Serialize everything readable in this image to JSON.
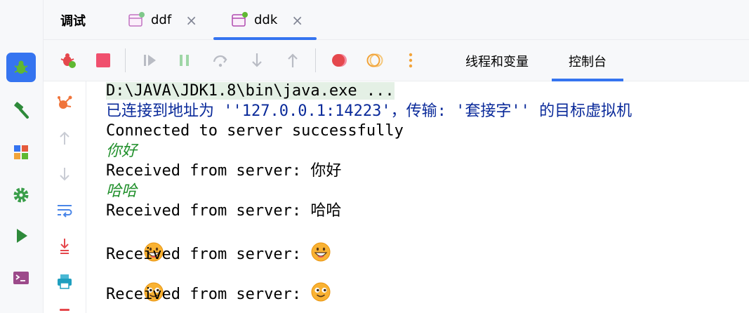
{
  "header": {
    "debug_title": "调试",
    "tabs": [
      {
        "label": "ddf",
        "close": "×"
      },
      {
        "label": "ddk",
        "close": "×"
      }
    ]
  },
  "toolbar": {
    "panel_tabs": [
      "线程和变量",
      "控制台"
    ]
  },
  "console": {
    "command": "D:\\JAVA\\JDK1.8\\bin\\java.exe ...",
    "connected_info": "已连接到地址为 ''127.0.0.1:14223'，传输: '套接字'' 的目标虚拟机",
    "connected": "Connected to server successfully",
    "input1": "你好",
    "received1": "Received from server: 你好",
    "input2": "哈哈",
    "received2": "Received from server: 哈哈",
    "received_prefix": "Received from server: "
  },
  "colors": {
    "accent": "#3574f0",
    "info_text": "#0a2a9a",
    "input_text": "#1f8f2a",
    "command_bg": "#e4f0e5"
  }
}
